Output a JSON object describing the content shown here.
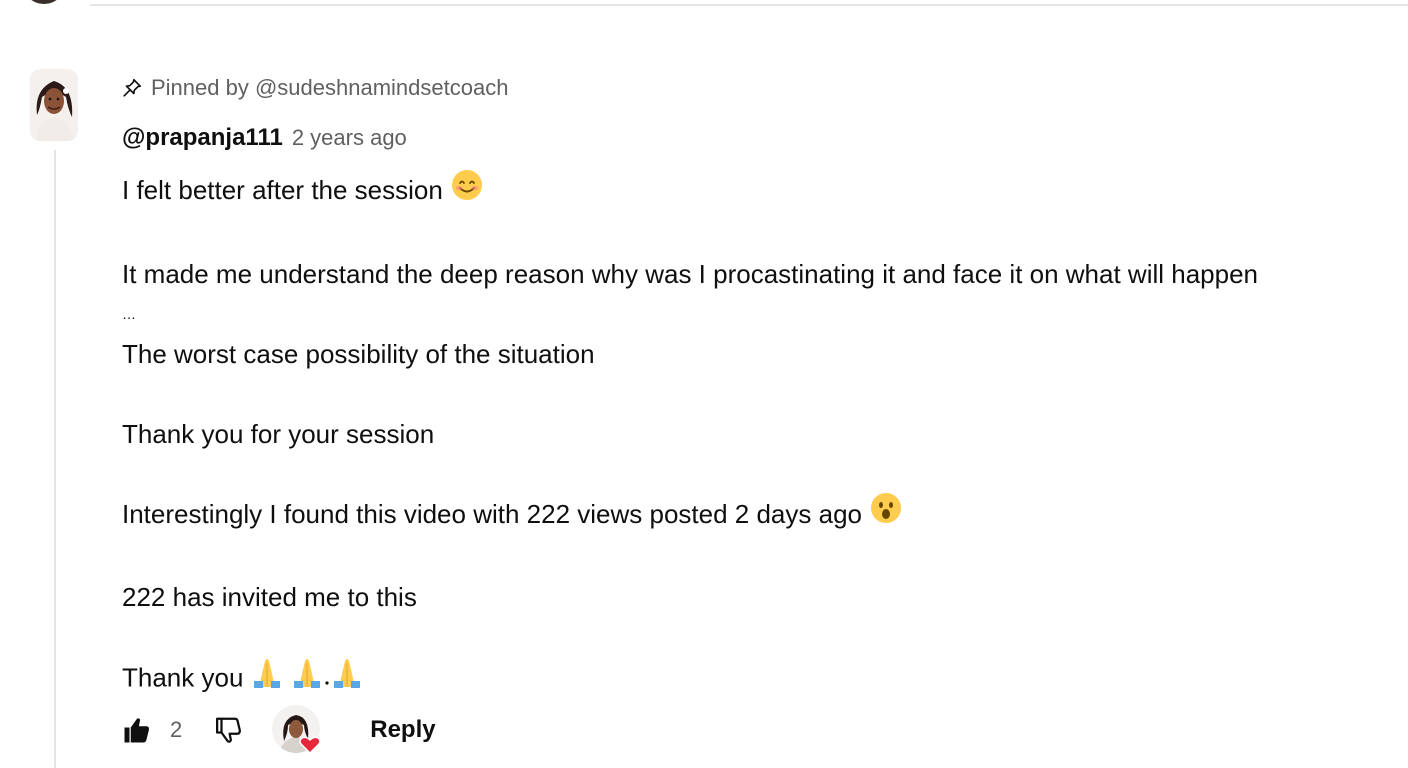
{
  "comment": {
    "pinned_label": "Pinned by @sudeshnamindsetcoach",
    "author": "@prapanja111",
    "timestamp": "2 years ago",
    "lines": {
      "l1": "I felt better after the session",
      "l2": "It made me understand the deep reason why was I procastinating it and face it on what will happen",
      "l3": "…",
      "l4": "The worst case possibility of the situation",
      "l5": "Thank you for your session",
      "l6": "Interestingly I found this video with 222 views posted 2 days ago",
      "l7": "222 has invited me to this",
      "l8": "Thank you"
    },
    "emoji": {
      "smiling": "smiling-face-emoji",
      "surprised": "surprised-face-emoji",
      "praying": "folded-hands-emoji"
    },
    "actions": {
      "like_count": "2",
      "reply_label": "Reply"
    }
  },
  "colors": {
    "text_primary": "#0f0f0f",
    "text_secondary": "#606060",
    "divider": "#e5e5e5",
    "heart": "#e8283a"
  }
}
